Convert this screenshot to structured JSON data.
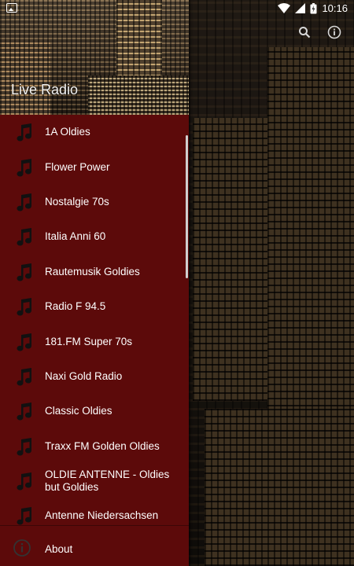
{
  "status_bar": {
    "time": "10:16"
  },
  "drawer": {
    "title": "Live Radio",
    "stations": [
      {
        "label": "1A Oldies"
      },
      {
        "label": "Flower Power"
      },
      {
        "label": "Nostalgie 70s"
      },
      {
        "label": "Italia Anni 60"
      },
      {
        "label": "Rautemusik Goldies"
      },
      {
        "label": "Radio F 94.5"
      },
      {
        "label": "181.FM Super 70s"
      },
      {
        "label": "Naxi Gold Radio"
      },
      {
        "label": "Classic Oldies"
      },
      {
        "label": "Traxx FM Golden Oldies"
      },
      {
        "label": "OLDIE ANTENNE - Oldies but Goldies"
      },
      {
        "label": "Antenne Niedersachsen"
      }
    ],
    "about_label": "About"
  },
  "colors": {
    "drawer_bg": "#5c0a0a",
    "text": "#ffffff"
  },
  "icons": {
    "station": "music-note-icon",
    "about": "info-icon",
    "search": "search-icon",
    "info_top": "info-icon"
  }
}
